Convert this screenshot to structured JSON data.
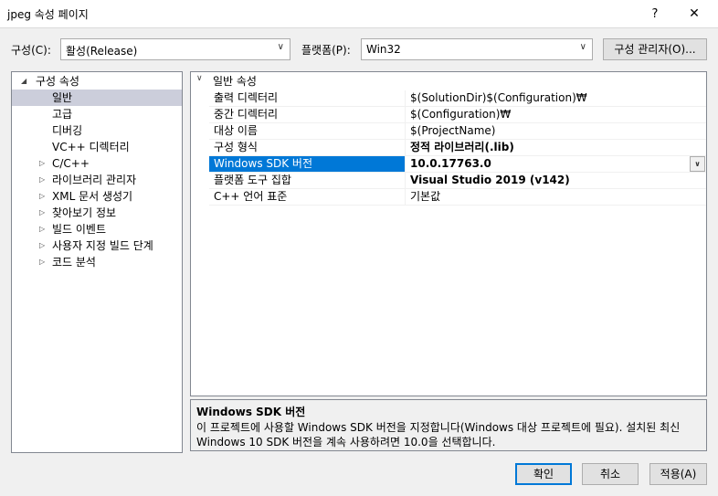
{
  "window": {
    "title": "jpeg 속성 페이지",
    "help": "?",
    "close": "✕"
  },
  "toolbar": {
    "config_label": "구성(C):",
    "config_value": "활성(Release)",
    "platform_label": "플랫폼(P):",
    "platform_value": "Win32",
    "config_manager_button": "구성 관리자(O)..."
  },
  "tree": {
    "items": [
      {
        "label": "구성 속성",
        "expander": "◢"
      },
      {
        "label": "일반"
      },
      {
        "label": "고급"
      },
      {
        "label": "디버깅"
      },
      {
        "label": "VC++ 디렉터리"
      },
      {
        "label": "C/C++",
        "expander": "▷"
      },
      {
        "label": "라이브러리 관리자",
        "expander": "▷"
      },
      {
        "label": "XML 문서 생성기",
        "expander": "▷"
      },
      {
        "label": "찾아보기 정보",
        "expander": "▷"
      },
      {
        "label": "빌드 이벤트",
        "expander": "▷"
      },
      {
        "label": "사용자 지정 빌드 단계",
        "expander": "▷"
      },
      {
        "label": "코드 분석",
        "expander": "▷"
      }
    ]
  },
  "grid": {
    "category": "일반 속성",
    "category_expander": "∨",
    "rows": [
      {
        "name": "출력 디렉터리",
        "value": "$(SolutionDir)$(Configuration)₩"
      },
      {
        "name": "중간 디렉터리",
        "value": "$(Configuration)₩"
      },
      {
        "name": "대상 이름",
        "value": "$(ProjectName)"
      },
      {
        "name": "구성 형식",
        "value": "정적 라이브러리(.lib)"
      },
      {
        "name": "Windows SDK 버전",
        "value": "10.0.17763.0",
        "dropdown": "∨"
      },
      {
        "name": "플랫폼 도구 집합",
        "value": "Visual Studio 2019 (v142)"
      },
      {
        "name": "C++ 언어 표준",
        "value": "기본값"
      }
    ]
  },
  "description": {
    "title": "Windows SDK 버전",
    "text": "이 프로젝트에 사용할 Windows SDK 버전을 지정합니다(Windows 대상 프로젝트에 필요). 설치된 최신 Windows 10 SDK 버전을 계속 사용하려면 10.0을 선택합니다."
  },
  "buttons": {
    "ok": "확인",
    "cancel": "취소",
    "apply": "적용(A)"
  },
  "combo_arrow": "∨"
}
